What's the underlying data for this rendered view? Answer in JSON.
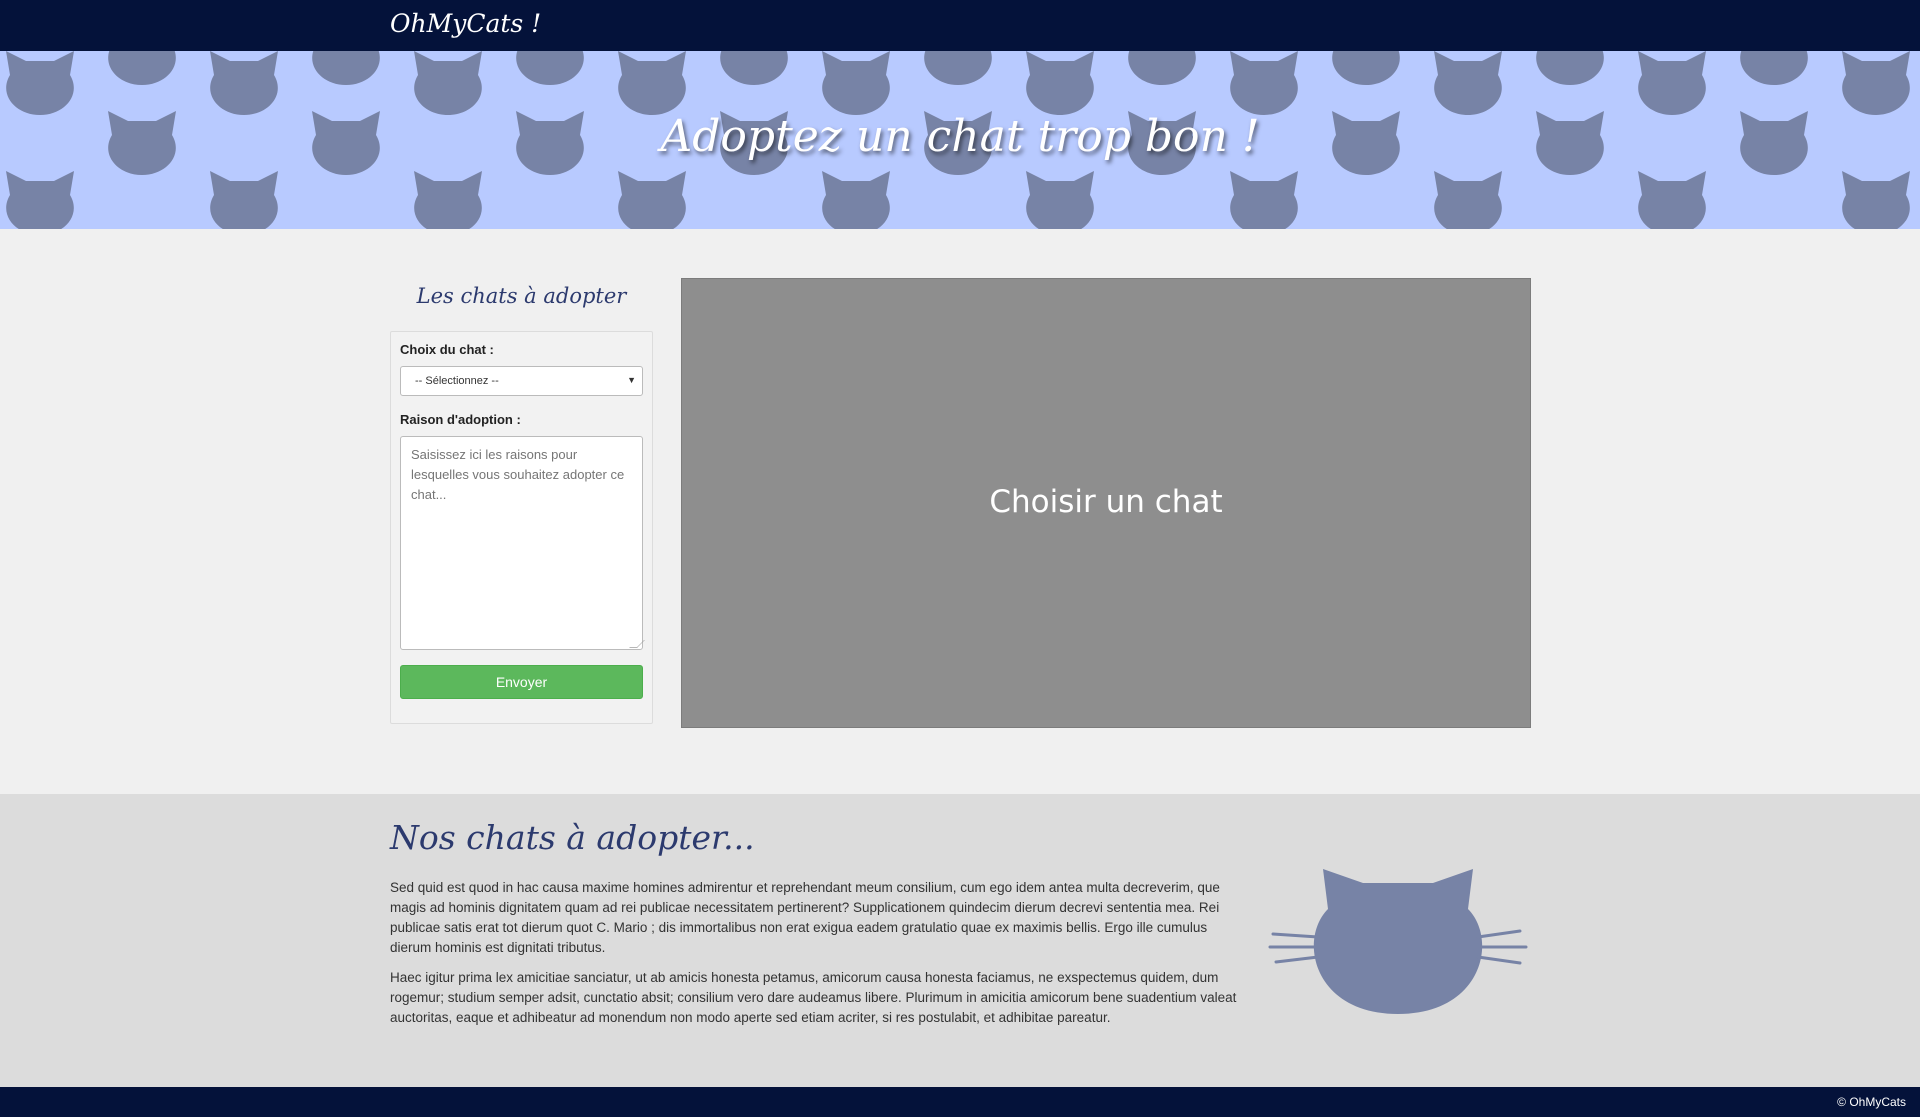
{
  "navbar": {
    "brand": "OhMyCats !"
  },
  "hero": {
    "title": "Adoptez un chat trop bon !"
  },
  "sidebar": {
    "title": "Les chats à adopter",
    "choice_label": "Choix du chat :",
    "select_value": "-- Sélectionnez --",
    "reason_label": "Raison d'adoption :",
    "reason_placeholder": "Saisissez ici les raisons pour lesquelles vous souhaitez adopter ce chat...",
    "submit_label": "Envoyer"
  },
  "viewer": {
    "text": "Choisir un chat"
  },
  "about": {
    "title": "Nos chats à adopter...",
    "paragraphs": [
      "Sed quid est quod in hac causa maxime homines admirentur et reprehendant meum consilium, cum ego idem antea multa decreverim, que magis ad hominis dignitatem quam ad rei publicae necessitatem pertinerent? Supplicationem quindecim dierum decrevi sententia mea. Rei publicae satis erat tot dierum quot C. Mario ; dis immortalibus non erat exigua eadem gratulatio quae ex maximis bellis. Ergo ille cumulus dierum hominis est dignitati tributus.",
      "Haec igitur prima lex amicitiae sanciatur, ut ab amicis honesta petamus, amicorum causa honesta faciamus, ne exspectemus quidem, dum rogemur; studium semper adsit, cunctatio absit; consilium vero dare audeamus libere. Plurimum in amicitia amicorum bene suadentium valeat auctoritas, eaque et adhibeatur ad monendum non modo aperte sed etiam acriter, si res postulabit, et adhibitae pareatur."
    ]
  },
  "footer": {
    "copyright": "© OhMyCats"
  },
  "icons": {
    "pattern": "cat-head-icon",
    "about_image": "cat-face-icon",
    "select_arrow": "caret-down-icon"
  },
  "colors": {
    "navbar": "#04123a",
    "hero_bg": "#b8caff",
    "cat": "#7783a6",
    "accent_title": "#2c3a6e",
    "button": "#5cb85c",
    "viewer": "#8e8e8e"
  }
}
